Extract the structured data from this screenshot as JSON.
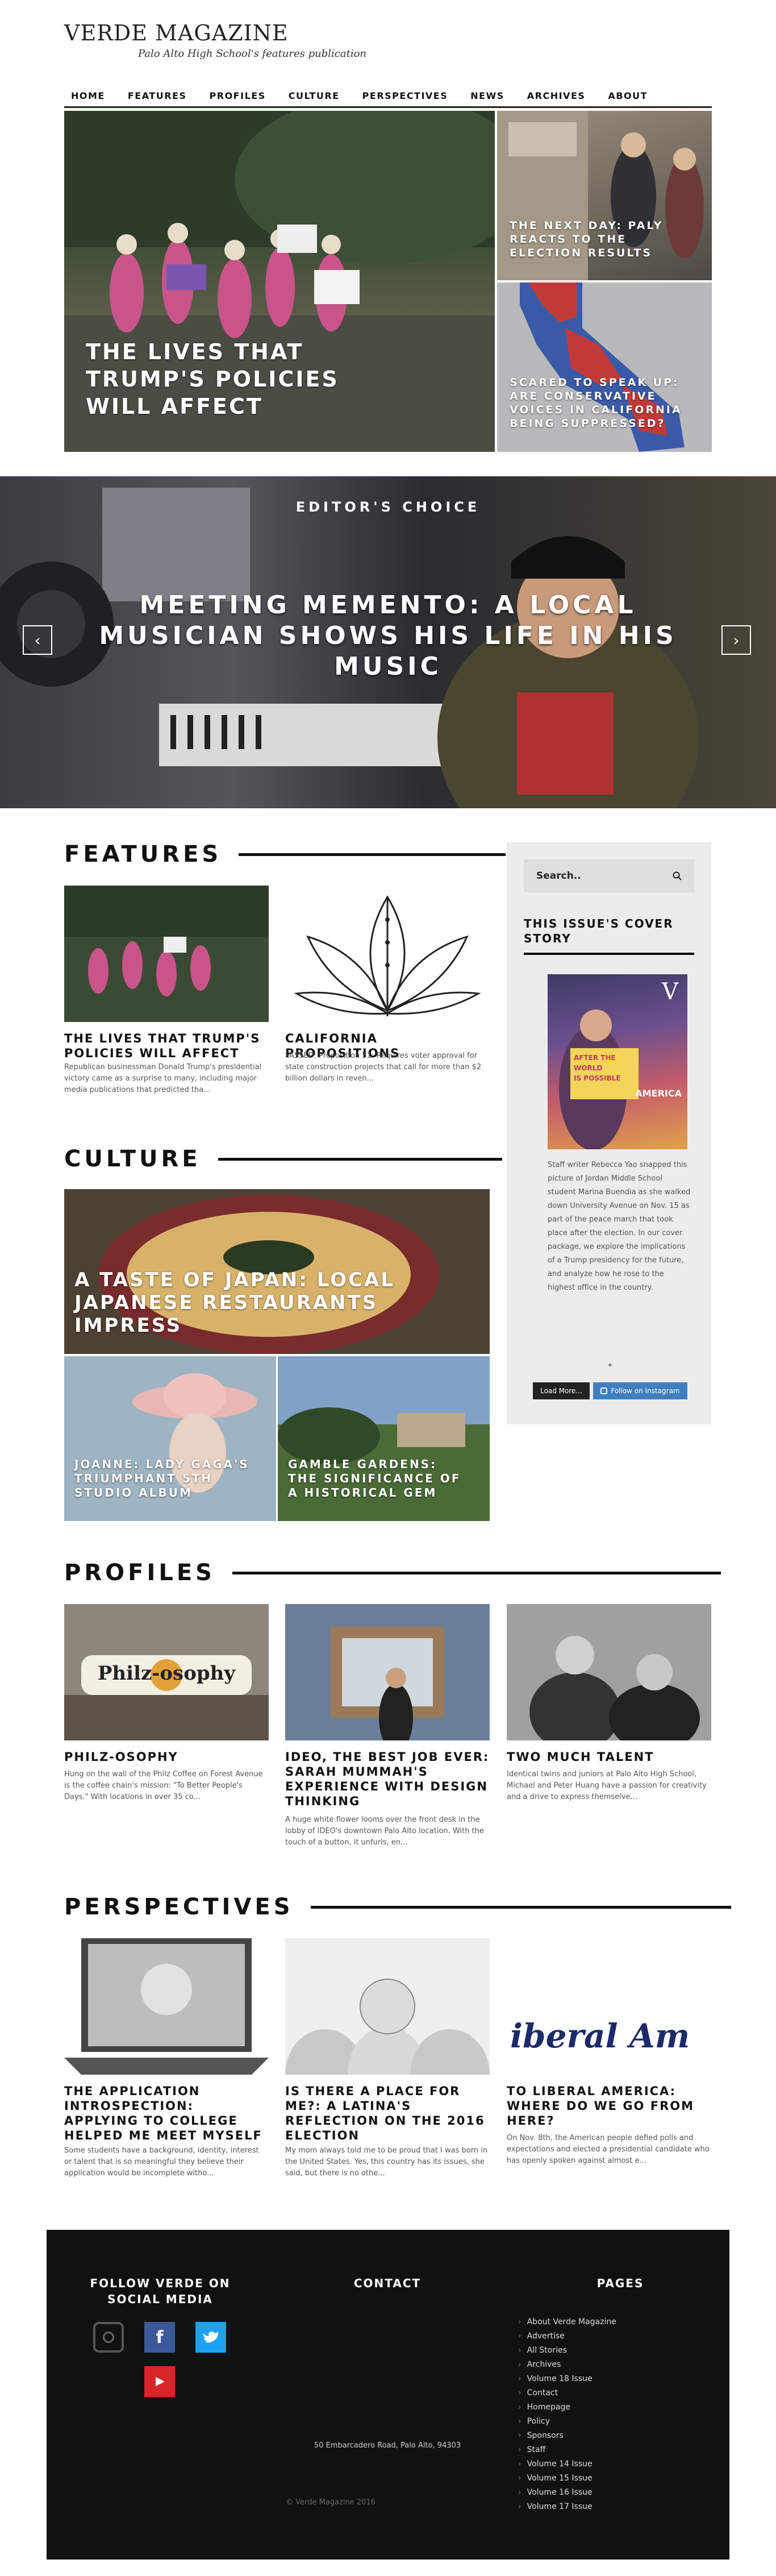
{
  "site": {
    "title": "VERDE MAGAZINE",
    "tagline": "Palo Alto High School's features publication"
  },
  "nav": [
    "HOME",
    "FEATURES",
    "PROFILES",
    "CULTURE",
    "PERSPECTIVES",
    "NEWS",
    "ARCHIVES",
    "ABOUT"
  ],
  "hero": {
    "main_title": "THE LIVES THAT TRUMP'S POLICIES WILL AFFECT",
    "side1_title": "THE NEXT DAY: PALY REACTS TO THE ELECTION RESULTS",
    "side2_title": "SCARED TO SPEAK UP: ARE CONSERVATIVE VOICES IN CALIFORNIA BEING SUPPRESSED?"
  },
  "slider": {
    "label": "EDITOR'S CHOICE",
    "headline": "MEETING MEMENTO: A LOCAL MUSICIAN SHOWS HIS LIFE IN HIS MUSIC",
    "prev": "‹",
    "next": "›"
  },
  "features": {
    "heading": "FEATURES",
    "items": [
      {
        "title": "THE LIVES THAT TRUMP'S POLICIES WILL AFFECT",
        "excerpt": "Republican businessman Donald Trump's presidential victory came as a surprise to many, including major media publications that predicted tha..."
      },
      {
        "title": "CALIFORNIA PROPOSITIONS",
        "excerpt": "PASSED: Proposition 51: Requires voter approval for state construction projects that call for more than $2 billion dollars in reven..."
      }
    ]
  },
  "culture": {
    "heading": "CULTURE",
    "main_title": "A TASTE OF JAPAN: LOCAL JAPANESE RESTAURANTS IMPRESS",
    "left_title": "JOANNE: LADY GAGA'S TRIUMPHANT 5TH STUDIO ALBUM",
    "right_title": "GAMBLE GARDENS: THE SIGNIFICANCE OF A HISTORICAL GEM"
  },
  "sidebar": {
    "search_placeholder": "Search..",
    "widget_title": "THIS ISSUE'S COVER STORY",
    "cover_lines": [
      "V",
      "AFTER THE",
      "WORLD",
      "IS POSSIBLE",
      "AMERICA"
    ],
    "caption": "Staff writer Rebecca Yao snapped this picture of Jordan Middle School student Marina Buendia as she walked down University Avenue on Nov. 15 as part of the peace march that took place after the election. In our cover package, we explore the implications of a Trump presidency for the future, and analyze how he rose to the highest office in the country.",
    "load_more": "Load More...",
    "follow": "Follow on Instagram"
  },
  "profiles": {
    "heading": "PROFILES",
    "items": [
      {
        "title": "PHILZ-OSOPHY",
        "img_text": "Philz-osophy",
        "excerpt": "Hung on the wall of the Philz Coffee on Forest Avenue is the coffee chain's mission: \"To Better People's Days.\" With locations in over 35 co..."
      },
      {
        "title": "IDEO, THE BEST JOB EVER: SARAH MUMMAH'S EXPERIENCE WITH DESIGN THINKING",
        "excerpt": "A huge white flower looms over the front desk in the lobby of IDEO's downtown Palo Alto location. With the touch of a button, it unfurls, en..."
      },
      {
        "title": "TWO MUCH TALENT",
        "excerpt": "Identical twins and juniors at Palo Alto High School, Michael and Peter Huang have a passion for creativity and a drive to express themselve..."
      }
    ]
  },
  "perspectives": {
    "heading": "PERSPECTIVES",
    "items": [
      {
        "title": "THE APPLICATION INTROSPECTION: APPLYING TO COLLEGE HELPED ME MEET MYSELF",
        "excerpt": "Some students have a background, identity, interest or talent that is so meaningful they believe their application would be incomplete witho..."
      },
      {
        "title": "IS THERE A PLACE FOR ME?: A LATINA'S REFLECTION ON THE 2016 ELECTION",
        "excerpt": "My mom always told me to be proud that I was born in the United States. Yes, this country has its issues, she said, but there is no othe..."
      },
      {
        "title": "TO LIBERAL AMERICA: WHERE DO WE GO FROM HERE?",
        "img_text": "iberal Am",
        "excerpt": "On Nov. 8th, the American people defied polls and expectations and elected a presidential candidate who has openly spoken against almost e..."
      }
    ]
  },
  "footer": {
    "social_title": "FOLLOW VERDE ON SOCIAL MEDIA",
    "contact_title": "CONTACT",
    "pages_title": "PAGES",
    "address": "50 Embarcadero Road, Palo Alto, 94303",
    "copyright": "© Verde Magazine 2016",
    "pages": [
      "About Verde Magazine",
      "Advertise",
      "All Stories",
      "Archives",
      "Volume 18 Issue",
      "Contact",
      "Homepage",
      "Policy",
      "Sponsors",
      "Staff",
      "Volume 14 Issue",
      "Volume 15 Issue",
      "Volume 16 Issue",
      "Volume 17 Issue"
    ]
  },
  "colors": {
    "facebook": "#3b5998",
    "twitter": "#1da1f2",
    "youtube": "#d9252a",
    "button_blue": "#3f7fbf"
  }
}
